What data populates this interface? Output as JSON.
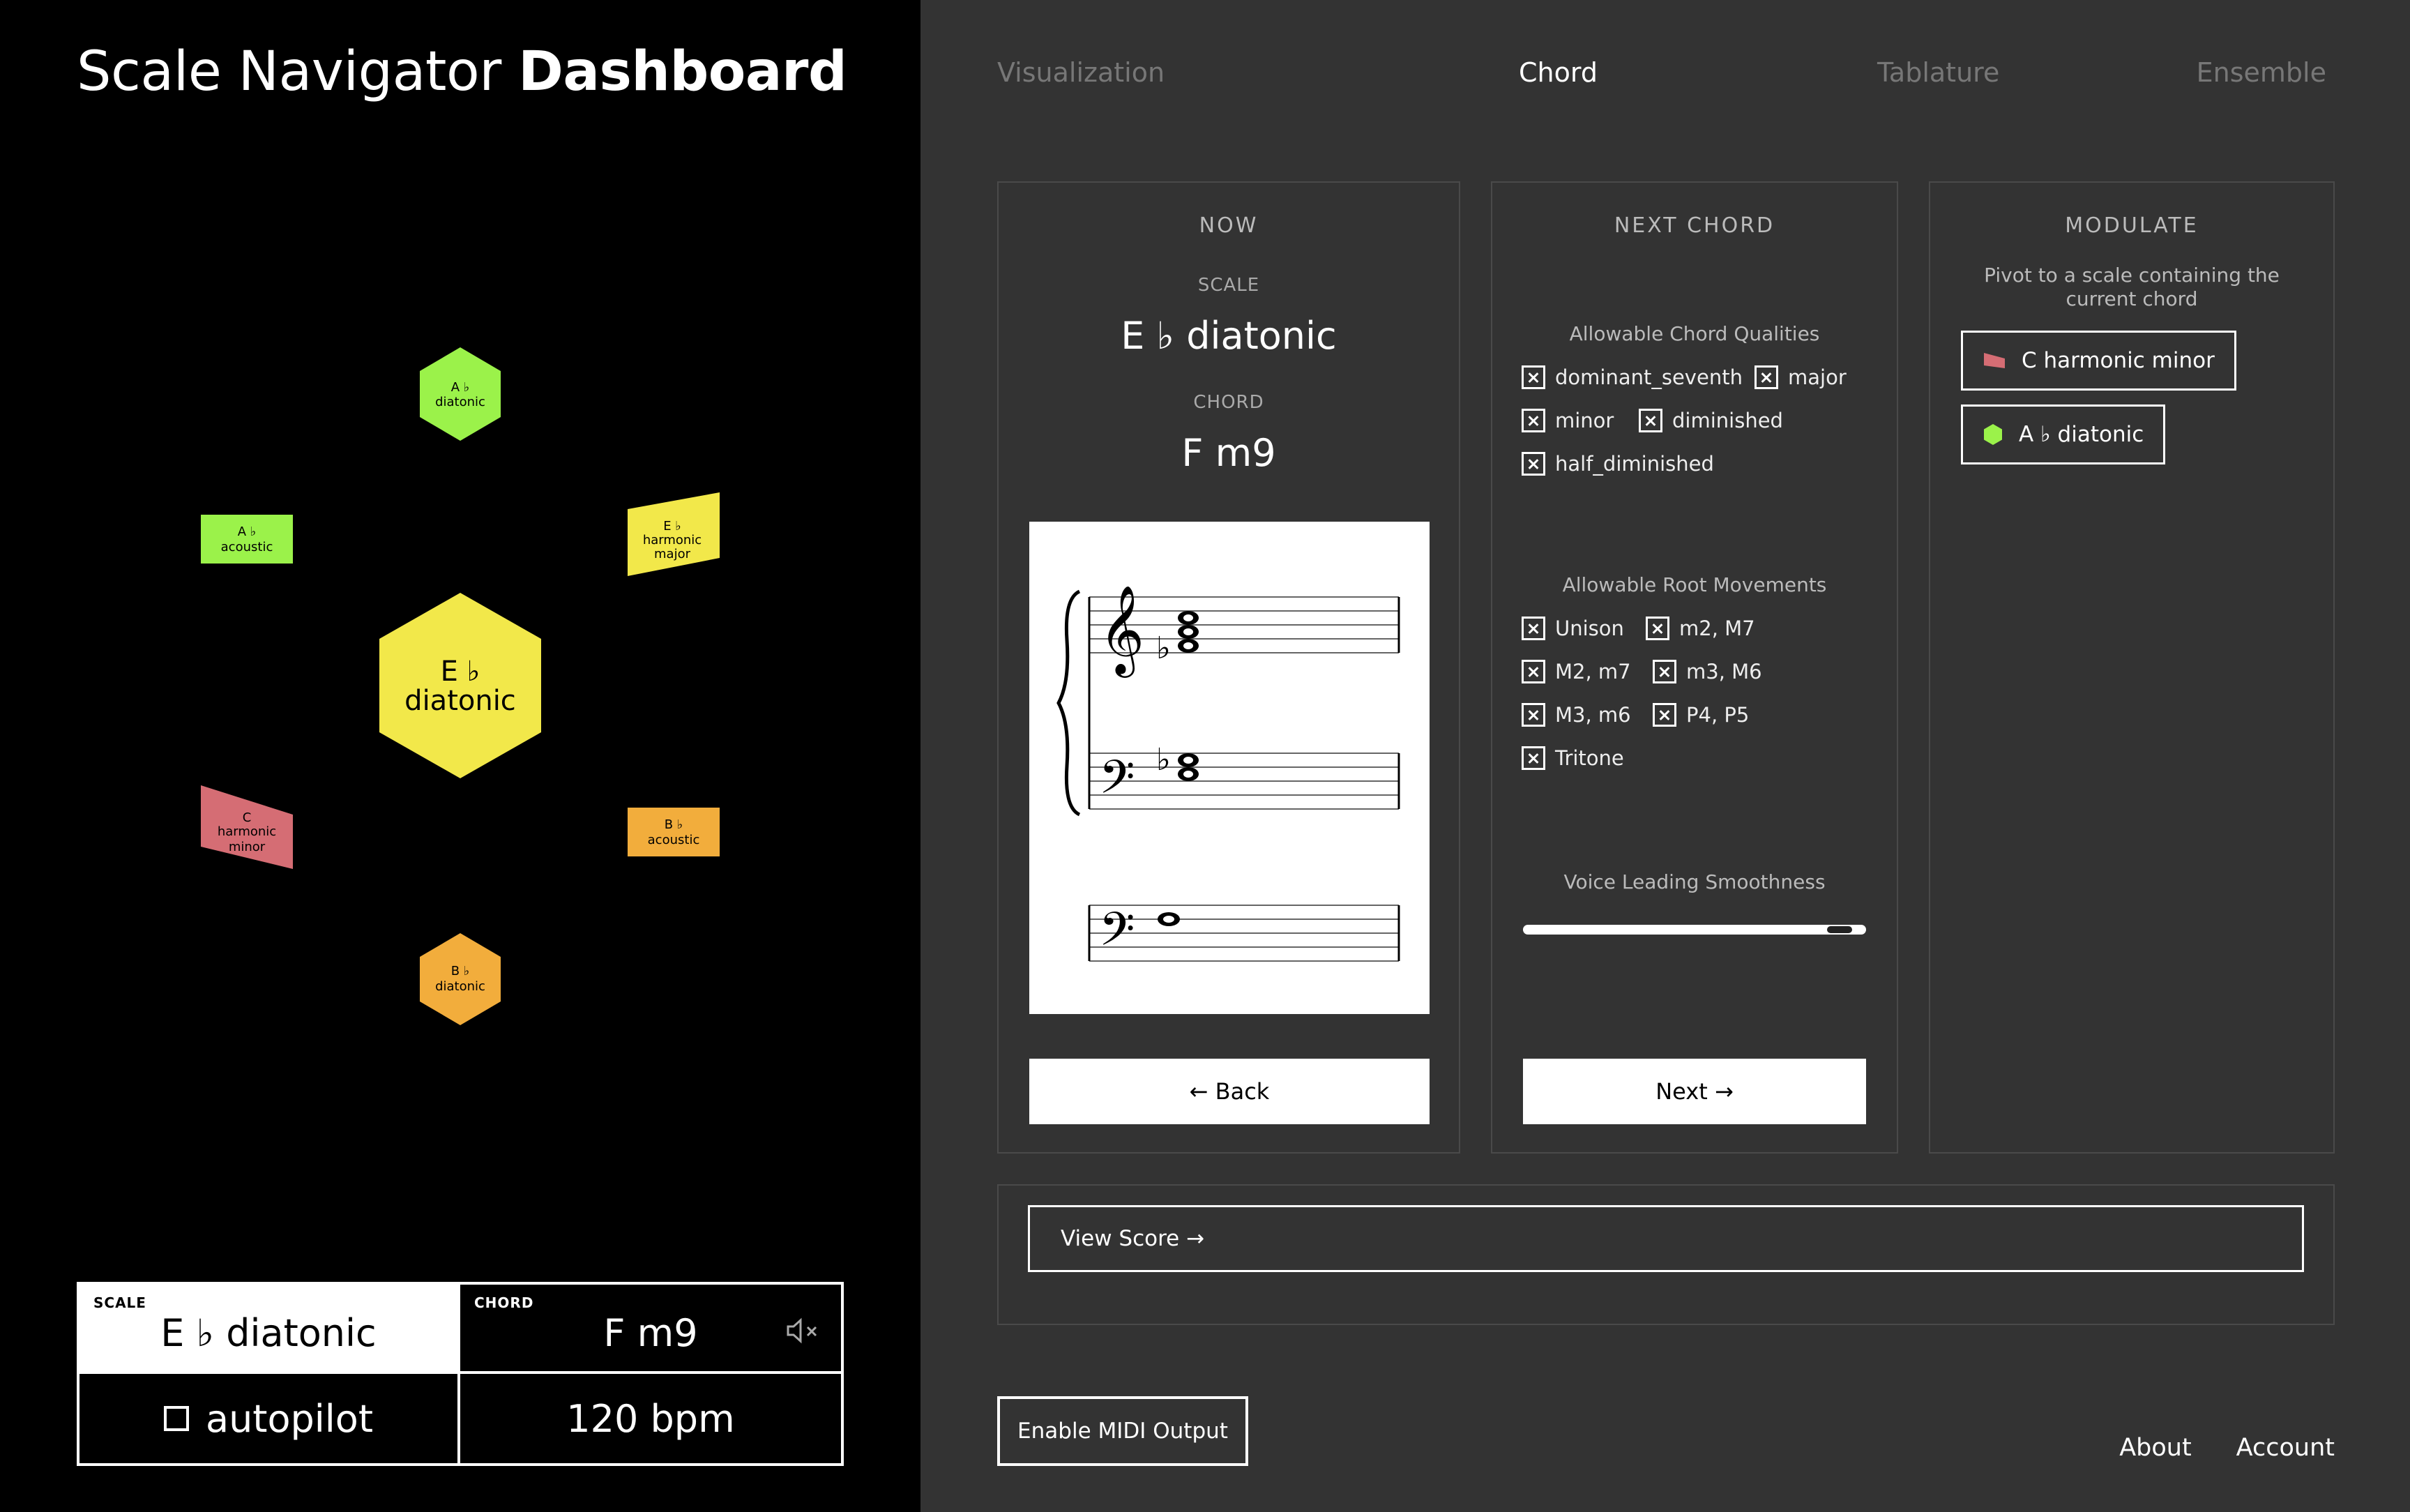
{
  "app": {
    "title_regular": "Scale Navigator ",
    "title_bold": "Dashboard"
  },
  "network": {
    "center": {
      "line1": "E ♭",
      "line2": "diatonic",
      "color": "#f2e84a"
    },
    "nodes": [
      {
        "id": "ab-diatonic",
        "lines": [
          "A ♭",
          "diatonic"
        ],
        "color": "#9bf24a",
        "shape": "hexagon"
      },
      {
        "id": "ab-acoustic",
        "lines": [
          "A ♭",
          "acoustic"
        ],
        "color": "#9bf24a",
        "shape": "rect"
      },
      {
        "id": "eb-harmonic-major",
        "lines": [
          "E ♭",
          "harmonic",
          "major"
        ],
        "color": "#f2e84a",
        "shape": "parallelogram"
      },
      {
        "id": "c-harmonic-minor",
        "lines": [
          "C",
          "harmonic",
          "minor"
        ],
        "color": "#d56d74",
        "shape": "trapezoid"
      },
      {
        "id": "bb-acoustic",
        "lines": [
          "B ♭",
          "acoustic"
        ],
        "color": "#f2ad3c",
        "shape": "rect"
      },
      {
        "id": "bb-diatonic",
        "lines": [
          "B ♭",
          "diatonic"
        ],
        "color": "#f2ad3c",
        "shape": "hexagon"
      }
    ]
  },
  "status": {
    "scale_label": "SCALE",
    "scale_value": "E ♭  diatonic",
    "chord_label": "CHORD",
    "chord_value": "F m9",
    "autopilot_label": "autopilot",
    "tempo": "120 bpm"
  },
  "tabs": [
    {
      "label": "Visualization",
      "active": false
    },
    {
      "label": "Chord",
      "active": true
    },
    {
      "label": "Tablature",
      "active": false
    },
    {
      "label": "Ensemble",
      "active": false
    }
  ],
  "now": {
    "header": "NOW",
    "scale_label": "SCALE",
    "scale_value": "E ♭  diatonic",
    "chord_label": "CHORD",
    "chord_value": "F m9",
    "back_label": "← Back"
  },
  "next_chord": {
    "header": "NEXT CHORD",
    "qualities_label": "Allowable Chord Qualities",
    "qualities": [
      "dominant_seventh",
      "major",
      "minor",
      "diminished",
      "half_diminished"
    ],
    "movements_label": "Allowable Root Movements",
    "movements": [
      "Unison",
      "m2, M7",
      "M2, m7",
      "m3, M6",
      "M3, m6",
      "P4, P5",
      "Tritone"
    ],
    "smoothness_label": "Voice Leading Smoothness",
    "smoothness_value": 0.96,
    "next_label": "Next →"
  },
  "modulate": {
    "header": "MODULATE",
    "description": "Pivot to a scale containing the current chord",
    "options": [
      {
        "label": "C harmonic minor",
        "color": "#d56d74",
        "icon": "trapezoid-icon"
      },
      {
        "label": "A ♭  diatonic",
        "color": "#9bf24a",
        "icon": "hexagon-icon"
      }
    ]
  },
  "view_score_label": "View Score →",
  "midi_label": "Enable MIDI Output",
  "footer": {
    "about": "About",
    "account": "Account"
  }
}
